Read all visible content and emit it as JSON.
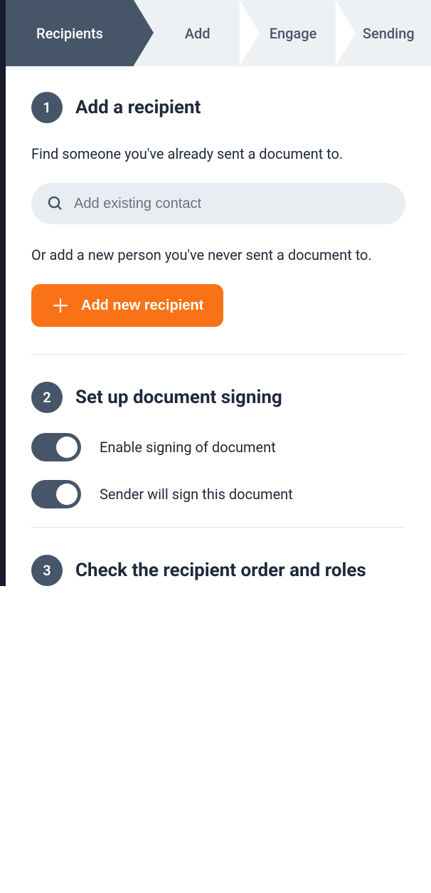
{
  "stepper": {
    "steps": [
      {
        "label": "Recipients",
        "active": true
      },
      {
        "label": "Add",
        "active": false
      },
      {
        "label": "Engage",
        "active": false
      },
      {
        "label": "Sending",
        "active": false
      }
    ]
  },
  "section1": {
    "number": "1",
    "title": "Add a recipient",
    "description1": "Find someone you've already sent a document to.",
    "searchPlaceholder": "Add existing contact",
    "description2": "Or add a new person you've never sent a document to.",
    "addButtonLabel": "Add new recipient"
  },
  "section2": {
    "number": "2",
    "title": "Set up document signing",
    "toggle1Label": "Enable signing of document",
    "toggle1On": true,
    "toggle2Label": "Sender will sign this document",
    "toggle2On": true
  },
  "section3": {
    "number": "3",
    "title": "Check the recipient order and roles"
  },
  "colors": {
    "primary": "#475569",
    "accent": "#f97316",
    "background": "#eef1f4",
    "text": "#1e293b"
  }
}
